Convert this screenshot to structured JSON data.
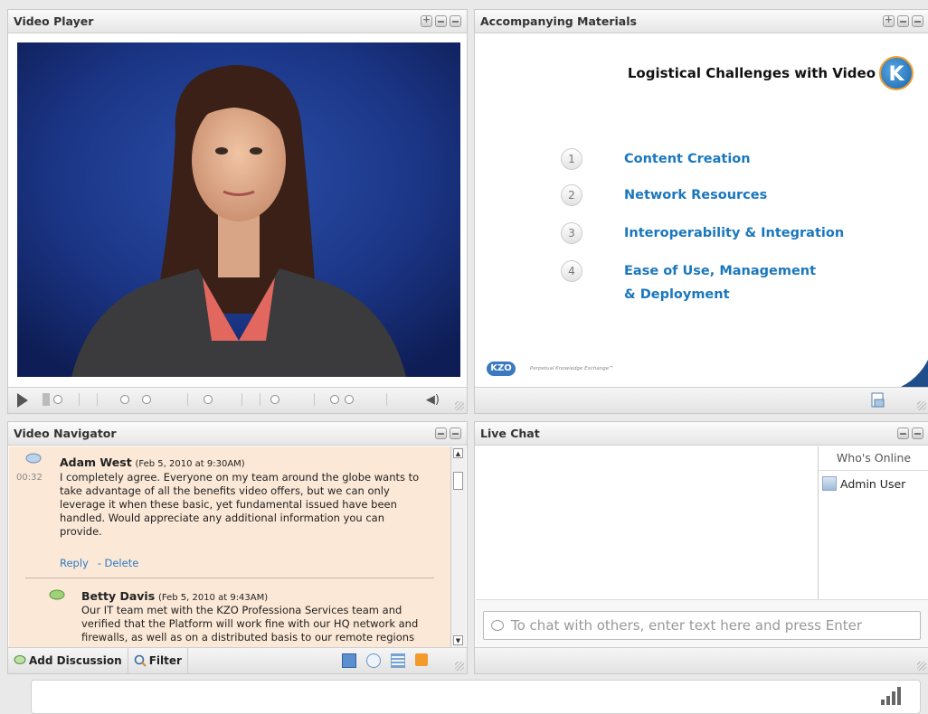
{
  "video_player": {
    "title": "Video Player"
  },
  "accompanying_materials": {
    "title": "Accompanying Materials",
    "slide": {
      "title": "Logistical Challenges with Video",
      "logo_letter": "K",
      "items": [
        {
          "num": "1",
          "text": "Content Creation"
        },
        {
          "num": "2",
          "text": "Network Resources"
        },
        {
          "num": "3",
          "text": "Interoperability & Integration"
        },
        {
          "num": "4",
          "text": "Ease of Use, Management",
          "text2": "& Deployment"
        }
      ],
      "footer_brand": "KZO",
      "footer_tagline": "Perpetual Knowledge Exchange™"
    }
  },
  "video_navigator": {
    "title": "Video Navigator",
    "entry1": {
      "author": "Adam West",
      "date": "(Feb 5, 2010 at 9:30AM)",
      "timestamp": "00:32",
      "lines": [
        "I completely agree. Everyone on my team around the globe wants to",
        "take advantage of all the benefits video offers, but we can only",
        "leverage it when these basic, yet fundamental issued have been",
        "handled. Would appreciate any additional information you can",
        "provide."
      ],
      "reply": "Reply",
      "delete": "- Delete"
    },
    "entry2": {
      "author": "Betty Davis",
      "date": "(Feb 5, 2010 at 9:43AM)",
      "lines": [
        "Our IT team met with the KZO Professiona Services team and",
        "verified that the Platform will work fine with our HQ network and",
        "firewalls, as well as on a distributed basis to our remote regions"
      ]
    },
    "add_discussion": "Add Discussion",
    "filter": "Filter"
  },
  "live_chat": {
    "title": "Live Chat",
    "whos_online": "Who's Online",
    "users": [
      "Admin User"
    ],
    "input_placeholder": "To chat with others, enter text here and press Enter"
  },
  "colors": {
    "accent_blue": "#1b77bd",
    "navigator_bg": "#fbe8d6"
  }
}
